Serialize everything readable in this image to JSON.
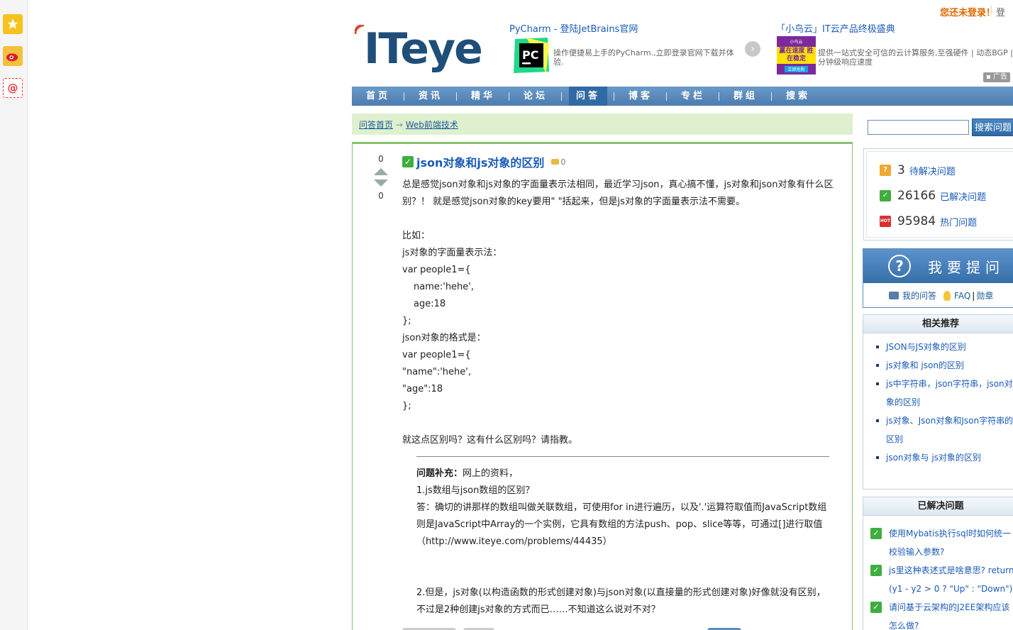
{
  "share_bar": {
    "items": [
      "favorite-icon",
      "weibo-icon",
      "email-icon"
    ]
  },
  "header": {
    "login_tip": "您还未登录！",
    "login_link": "登"
  },
  "logo": {
    "text": "ITeye"
  },
  "ads": {
    "ad1": {
      "title": "PyCharm - 登陆JetBrains官网",
      "icon_text": "PC",
      "desc": "操作便捷易上手的PyCharm.,立即登录官网下载并体验."
    },
    "ad2": {
      "title": "「小鸟云」IT云产品终极盛典",
      "icon_line1": "小鸟云",
      "icon_line2": "赢在速度 胜在稳定",
      "icon_line3": "立即抢购",
      "desc": "提供一站式安全可信的云计算服务,至强硬件 | 动态BGP | 分钟级响应速度"
    },
    "badge": "广告"
  },
  "nav": {
    "items": [
      "首页",
      "资讯",
      "精华",
      "论坛",
      "问答",
      "博客",
      "专栏",
      "群组",
      "搜索"
    ],
    "active_index": 4
  },
  "breadcrumb": {
    "home": "问答首页",
    "arrow": "→",
    "category": "Web前端技术"
  },
  "question": {
    "votes_up": "0",
    "votes_down": "0",
    "title": "json对象和js对象的区别",
    "coins": "0",
    "body": {
      "p1": "总是感觉json对象和js对象的字面量表示法相同，最近学习json，真心搞不懂，js对象和json对象有什么区别？！ 就是感觉json对象的key要用\" \"括起来，但是js对象的字面量表示法不需要。",
      "l1": "比如：",
      "l2": "js对象的字面量表示法：",
      "l3": "var people1={",
      "l4": "name:'hehe',",
      "l5": "age:18",
      "l6": "};",
      "l7": "json对象的格式是：",
      "l8": "var people1={",
      "l9": "\"name\":'hehe',",
      "l10": "\"age\":18",
      "l11": "};",
      "l12": "就这点区别吗？这有什么区别吗？请指教。"
    },
    "supplement": {
      "label": "问题补充：",
      "intro": "网上的资料，",
      "s1": "1.js数组与json数组的区别？",
      "s2": "答：确切的讲那样的数组叫做关联数组，可使用for in进行遍历，以及'.'运算符取值而JavaScript数组则是JavaScript中Array的一个实例，它具有数组的方法push、pop、slice等等，可通过[]进行取值 （http://www.iteye.com/problems/44435）",
      "s3": "2.但是，js对象(以构造函数的形式创建对象)与json对象(以直接量的形式创建对象)好像就没有区别，不过是2种创建js对象的方式而已……不知道这么说对不对？"
    }
  },
  "sidebar": {
    "search_button": "搜索问题",
    "search_value": "",
    "stats": [
      {
        "count": "3",
        "label": "待解决问题",
        "icon": "question-icon"
      },
      {
        "count": "26166",
        "label": "已解决问题",
        "icon": "check-icon"
      },
      {
        "count": "95984",
        "label": "热门问题",
        "icon": "hot-icon"
      }
    ],
    "ask": {
      "label": "我要提问",
      "my_questions": "我的问答",
      "faq": "FAQ",
      "sep": "|",
      "medals": "勋章"
    },
    "related": {
      "title": "相关推荐",
      "items": [
        "JSON与JS对象的区别",
        "js对象和 json的区别",
        "js中字符串，json字符串，json对象的区别",
        "js对象、Json对象和Json字符串的区别",
        "json对象与 js对象的区别"
      ]
    },
    "resolved": {
      "title": "已解决问题",
      "items": [
        "使用Mybatis执行sql时如何统一校验输入参数?",
        "js里这种表述式是啥意思? return (y1 - y2 > 0 ? \"Up\" : \"Down\");",
        "请问基于云架构的J2EE架构应该怎么做?"
      ]
    }
  }
}
